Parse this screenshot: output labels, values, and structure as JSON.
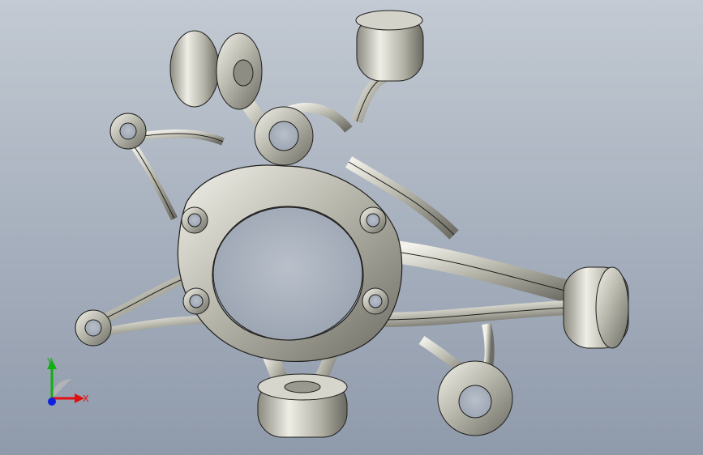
{
  "viewport": {
    "background_top": "#c3cad3",
    "background_bottom": "#8f9aab",
    "part": "knuckle-icon"
  },
  "triad": {
    "x_label": "X",
    "y_label": "Y",
    "x_color": "#e01010",
    "y_color": "#10b010",
    "z_color": "#1020e0"
  }
}
